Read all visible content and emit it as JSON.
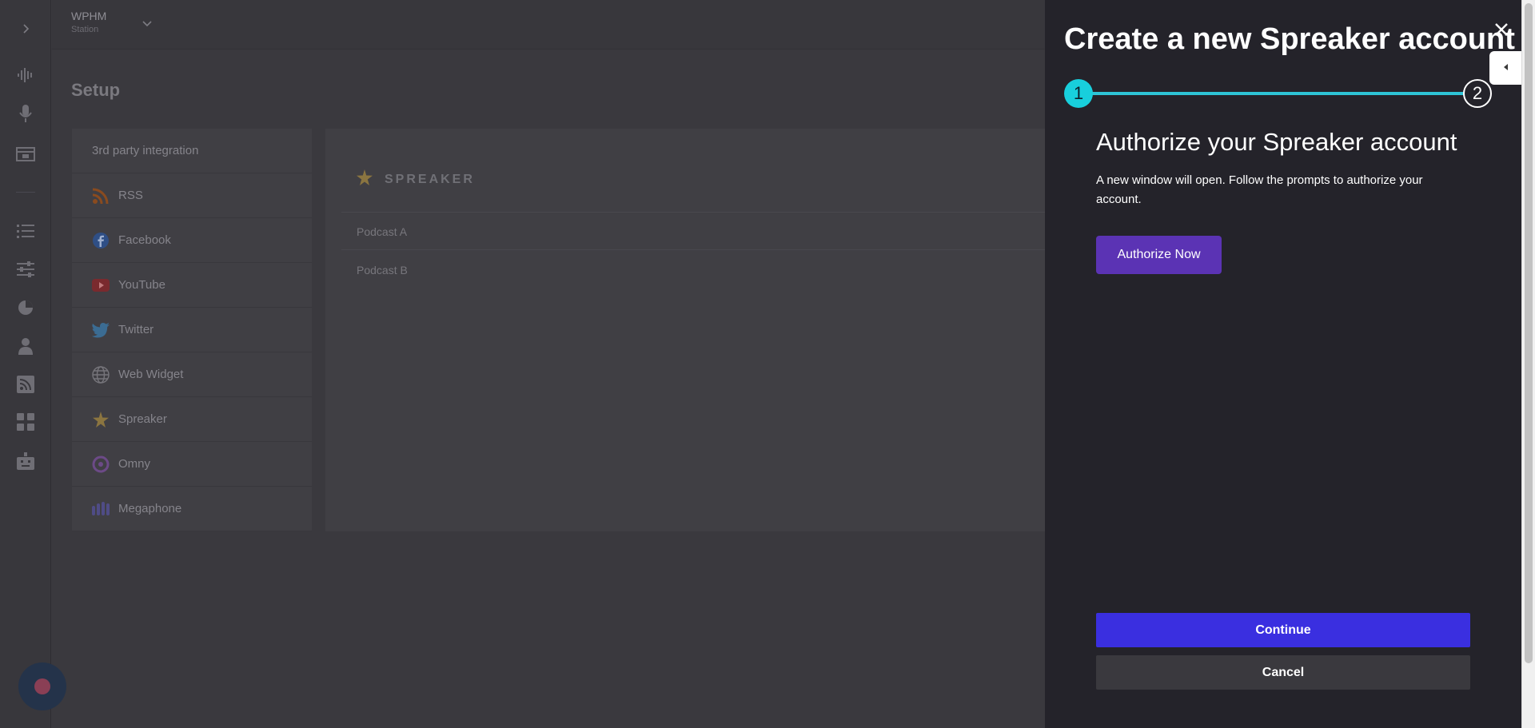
{
  "station": {
    "name": "WPHM",
    "sub": "Station"
  },
  "rail": {
    "icons": [
      "chevron-right-icon",
      "waveform-icon",
      "microphone-icon",
      "media-icon",
      "list-icon",
      "sliders-icon",
      "chart-pie-icon",
      "user-icon",
      "rss-feed-icon",
      "apps-grid-icon",
      "robot-icon"
    ]
  },
  "page": {
    "title": "Setup"
  },
  "integrations": {
    "heading": "3rd party integration",
    "items": [
      {
        "label": "RSS",
        "icon": "rss-icon"
      },
      {
        "label": "Facebook",
        "icon": "facebook-icon"
      },
      {
        "label": "YouTube",
        "icon": "youtube-icon"
      },
      {
        "label": "Twitter",
        "icon": "twitter-icon"
      },
      {
        "label": "Web Widget",
        "icon": "globe-icon"
      },
      {
        "label": "Spreaker",
        "icon": "spreaker-star-icon"
      },
      {
        "label": "Omny",
        "icon": "omny-icon"
      },
      {
        "label": "Megaphone",
        "icon": "megaphone-bars-icon"
      }
    ]
  },
  "panel": {
    "brand": "SPREAKER",
    "podcasts": [
      "Podcast A",
      "Podcast B"
    ]
  },
  "drawer": {
    "title": "Create a new Spreaker account",
    "step1": "1",
    "step2": "2",
    "heading": "Authorize your Spreaker account",
    "description": "A new window will open. Follow the prompts to authorize your account.",
    "authorize_label": "Authorize Now",
    "continue_label": "Continue",
    "cancel_label": "Cancel"
  },
  "colors": {
    "accent_teal": "#18cfdc",
    "authorize_purple": "#5b33b4",
    "continue_blue": "#3a2fe0",
    "drawer_bg": "#24232a"
  }
}
